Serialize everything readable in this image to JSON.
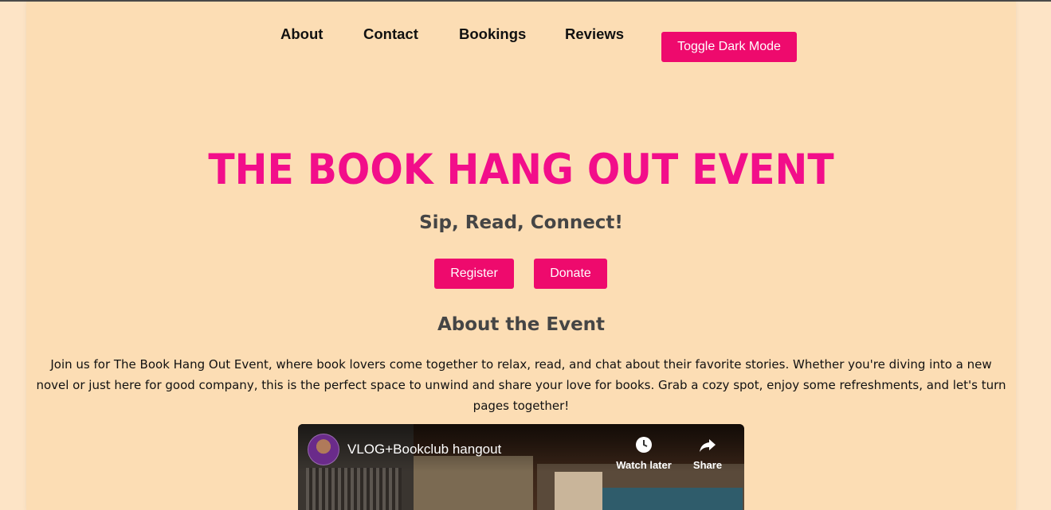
{
  "nav": {
    "items": [
      "About",
      "Contact",
      "Bookings",
      "Reviews"
    ],
    "toggle_label": "Toggle Dark Mode"
  },
  "hero": {
    "title": "THE BOOK HANG OUT EVENT",
    "tagline": "Sip, Read, Connect!",
    "register_label": "Register",
    "donate_label": "Donate"
  },
  "about": {
    "heading": "About the Event",
    "text": "Join us for The Book Hang Out Event, where book lovers come together to relax, read, and chat about their favorite stories. Whether you're diving into a new novel or just here for good company, this is the perfect space to unwind and share your love for books. Grab a cozy spot, enjoy some refreshments, and let's turn pages together!"
  },
  "video": {
    "title": "VLOG+Bookclub hangout",
    "watch_later_label": "Watch later",
    "share_label": "Share",
    "icons": [
      "clock-icon",
      "share-arrow-icon"
    ]
  },
  "colors": {
    "accent": "#ee0a6d",
    "title": "#f20e8a",
    "background": "#fcddb4",
    "outer_background": "#fde4c6",
    "heading_text": "#454545"
  }
}
